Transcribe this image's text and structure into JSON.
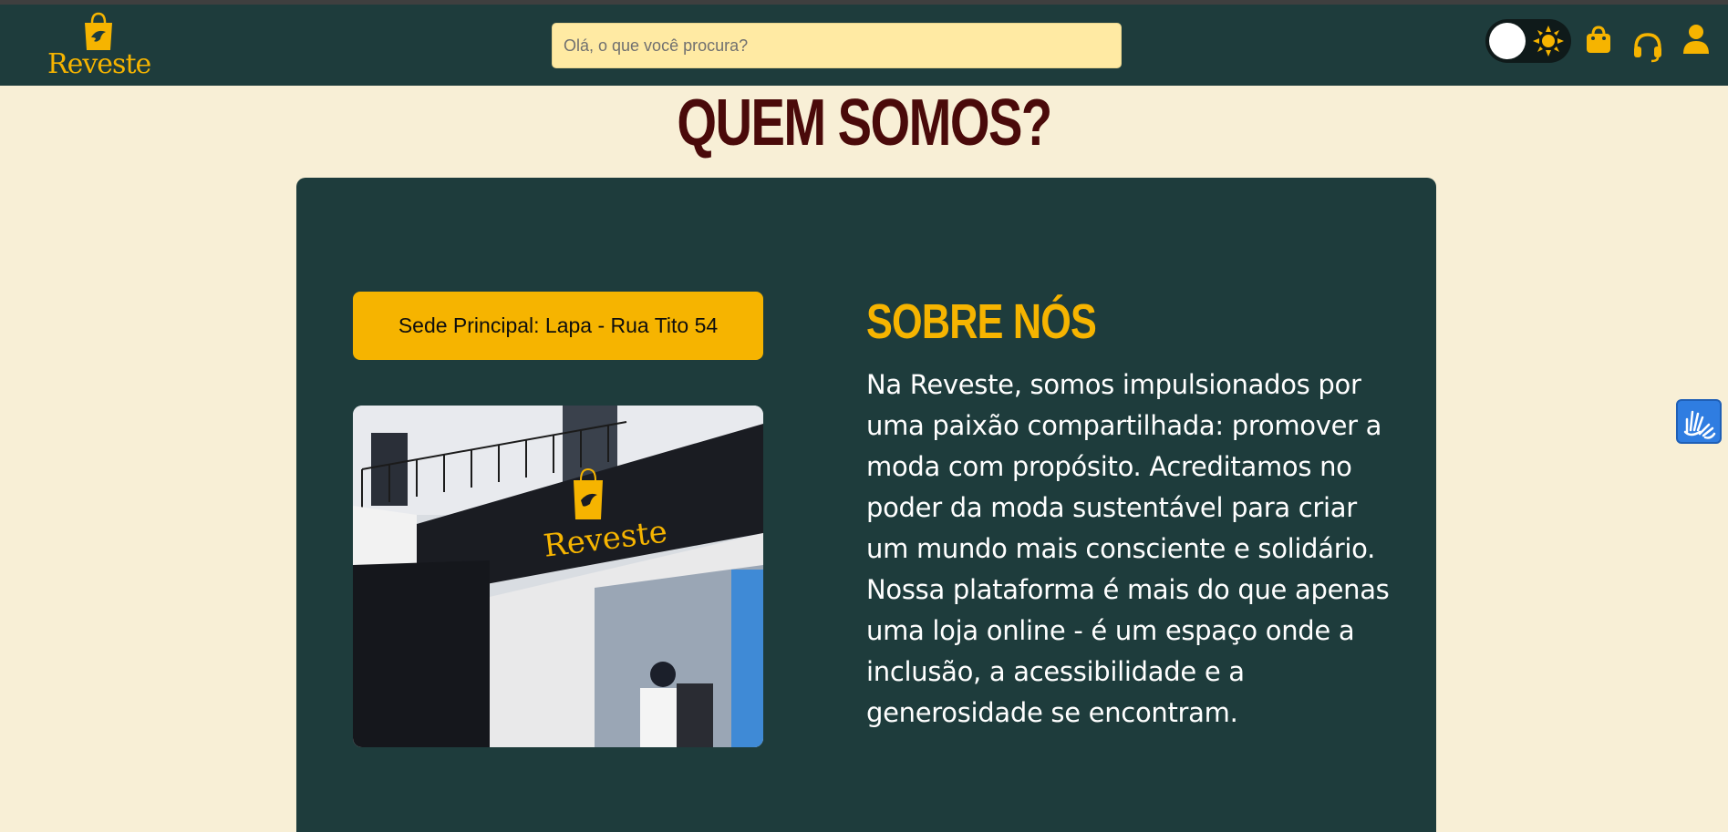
{
  "brand": {
    "name": "Reveste"
  },
  "search": {
    "placeholder": "Olá, o que você procura?"
  },
  "header": {
    "icons": [
      "theme-toggle",
      "shopping-bag-icon",
      "headset-icon",
      "user-icon"
    ]
  },
  "page": {
    "title": "QUEM SOMOS?"
  },
  "about": {
    "location_label": "Sede Principal: Lapa - Rua Tito 54",
    "heading": "SOBRE NÓS",
    "text": "Na Reveste, somos impulsionados por uma paixão compartilhada: promover a moda com propósito. Acreditamos no poder da moda sustentável para criar um mundo mais consciente e solidário. Nossa plataforma é mais do que apenas uma loja online - é um espaço onde a inclusão, a acessibilidade e a generosidade se encontram.",
    "storefront_sign": "Reveste"
  },
  "colors": {
    "header_bg": "#1e3c3c",
    "page_bg": "#f8efd6",
    "accent": "#f6b400",
    "title": "#4a0a0a",
    "search_bg": "#ffeaa3",
    "accessibility": "#2f7de1"
  }
}
